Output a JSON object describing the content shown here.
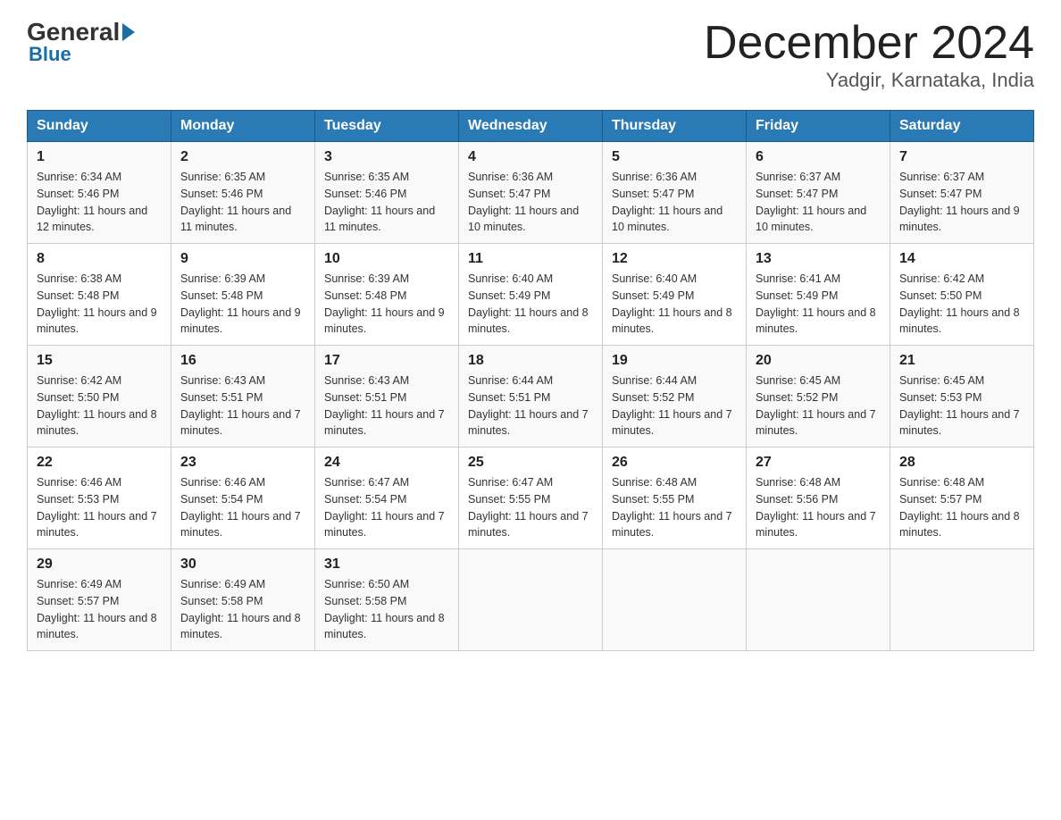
{
  "logo": {
    "general": "General",
    "blue": "Blue"
  },
  "title": {
    "month_year": "December 2024",
    "location": "Yadgir, Karnataka, India"
  },
  "headers": [
    "Sunday",
    "Monday",
    "Tuesday",
    "Wednesday",
    "Thursday",
    "Friday",
    "Saturday"
  ],
  "weeks": [
    [
      {
        "day": "1",
        "sunrise": "6:34 AM",
        "sunset": "5:46 PM",
        "daylight": "11 hours and 12 minutes."
      },
      {
        "day": "2",
        "sunrise": "6:35 AM",
        "sunset": "5:46 PM",
        "daylight": "11 hours and 11 minutes."
      },
      {
        "day": "3",
        "sunrise": "6:35 AM",
        "sunset": "5:46 PM",
        "daylight": "11 hours and 11 minutes."
      },
      {
        "day": "4",
        "sunrise": "6:36 AM",
        "sunset": "5:47 PM",
        "daylight": "11 hours and 10 minutes."
      },
      {
        "day": "5",
        "sunrise": "6:36 AM",
        "sunset": "5:47 PM",
        "daylight": "11 hours and 10 minutes."
      },
      {
        "day": "6",
        "sunrise": "6:37 AM",
        "sunset": "5:47 PM",
        "daylight": "11 hours and 10 minutes."
      },
      {
        "day": "7",
        "sunrise": "6:37 AM",
        "sunset": "5:47 PM",
        "daylight": "11 hours and 9 minutes."
      }
    ],
    [
      {
        "day": "8",
        "sunrise": "6:38 AM",
        "sunset": "5:48 PM",
        "daylight": "11 hours and 9 minutes."
      },
      {
        "day": "9",
        "sunrise": "6:39 AM",
        "sunset": "5:48 PM",
        "daylight": "11 hours and 9 minutes."
      },
      {
        "day": "10",
        "sunrise": "6:39 AM",
        "sunset": "5:48 PM",
        "daylight": "11 hours and 9 minutes."
      },
      {
        "day": "11",
        "sunrise": "6:40 AM",
        "sunset": "5:49 PM",
        "daylight": "11 hours and 8 minutes."
      },
      {
        "day": "12",
        "sunrise": "6:40 AM",
        "sunset": "5:49 PM",
        "daylight": "11 hours and 8 minutes."
      },
      {
        "day": "13",
        "sunrise": "6:41 AM",
        "sunset": "5:49 PM",
        "daylight": "11 hours and 8 minutes."
      },
      {
        "day": "14",
        "sunrise": "6:42 AM",
        "sunset": "5:50 PM",
        "daylight": "11 hours and 8 minutes."
      }
    ],
    [
      {
        "day": "15",
        "sunrise": "6:42 AM",
        "sunset": "5:50 PM",
        "daylight": "11 hours and 8 minutes."
      },
      {
        "day": "16",
        "sunrise": "6:43 AM",
        "sunset": "5:51 PM",
        "daylight": "11 hours and 7 minutes."
      },
      {
        "day": "17",
        "sunrise": "6:43 AM",
        "sunset": "5:51 PM",
        "daylight": "11 hours and 7 minutes."
      },
      {
        "day": "18",
        "sunrise": "6:44 AM",
        "sunset": "5:51 PM",
        "daylight": "11 hours and 7 minutes."
      },
      {
        "day": "19",
        "sunrise": "6:44 AM",
        "sunset": "5:52 PM",
        "daylight": "11 hours and 7 minutes."
      },
      {
        "day": "20",
        "sunrise": "6:45 AM",
        "sunset": "5:52 PM",
        "daylight": "11 hours and 7 minutes."
      },
      {
        "day": "21",
        "sunrise": "6:45 AM",
        "sunset": "5:53 PM",
        "daylight": "11 hours and 7 minutes."
      }
    ],
    [
      {
        "day": "22",
        "sunrise": "6:46 AM",
        "sunset": "5:53 PM",
        "daylight": "11 hours and 7 minutes."
      },
      {
        "day": "23",
        "sunrise": "6:46 AM",
        "sunset": "5:54 PM",
        "daylight": "11 hours and 7 minutes."
      },
      {
        "day": "24",
        "sunrise": "6:47 AM",
        "sunset": "5:54 PM",
        "daylight": "11 hours and 7 minutes."
      },
      {
        "day": "25",
        "sunrise": "6:47 AM",
        "sunset": "5:55 PM",
        "daylight": "11 hours and 7 minutes."
      },
      {
        "day": "26",
        "sunrise": "6:48 AM",
        "sunset": "5:55 PM",
        "daylight": "11 hours and 7 minutes."
      },
      {
        "day": "27",
        "sunrise": "6:48 AM",
        "sunset": "5:56 PM",
        "daylight": "11 hours and 7 minutes."
      },
      {
        "day": "28",
        "sunrise": "6:48 AM",
        "sunset": "5:57 PM",
        "daylight": "11 hours and 8 minutes."
      }
    ],
    [
      {
        "day": "29",
        "sunrise": "6:49 AM",
        "sunset": "5:57 PM",
        "daylight": "11 hours and 8 minutes."
      },
      {
        "day": "30",
        "sunrise": "6:49 AM",
        "sunset": "5:58 PM",
        "daylight": "11 hours and 8 minutes."
      },
      {
        "day": "31",
        "sunrise": "6:50 AM",
        "sunset": "5:58 PM",
        "daylight": "11 hours and 8 minutes."
      },
      null,
      null,
      null,
      null
    ]
  ],
  "labels": {
    "sunrise": "Sunrise:",
    "sunset": "Sunset:",
    "daylight": "Daylight:"
  }
}
